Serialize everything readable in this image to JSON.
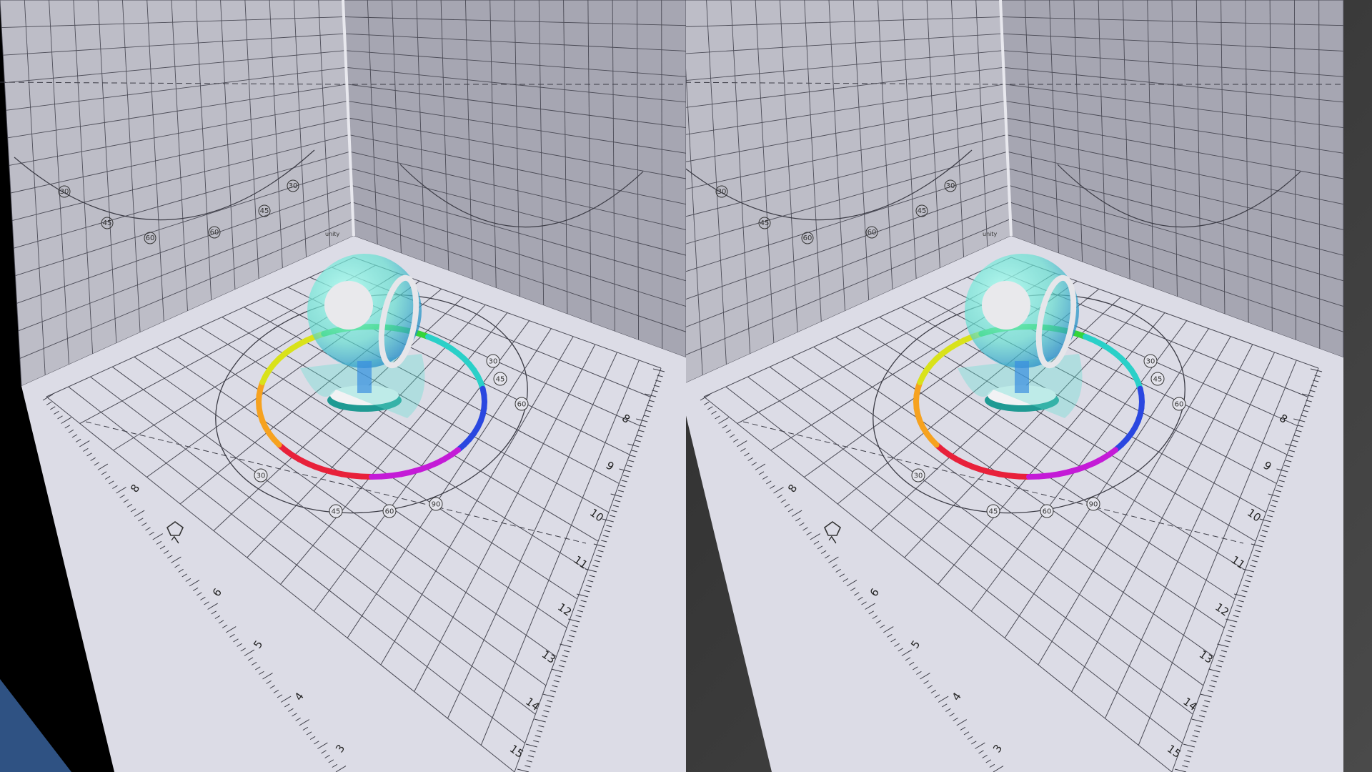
{
  "scene": {
    "views": [
      {
        "id": "left",
        "background": "#000000",
        "floor_color": "#dcdce6",
        "backwall_color": "#a6a6b2",
        "wall_brand": "unity",
        "wall_circle_labels": [
          "30",
          "45",
          "60",
          "60",
          "45",
          "30"
        ],
        "floor_circle_labels": [
          "30",
          "45",
          "60",
          "90",
          "60",
          "45",
          "30"
        ],
        "ruler_numbers": [
          "8",
          "9",
          "10",
          "11",
          "12",
          "13",
          "14",
          "15"
        ],
        "ruler_numbers_left": [
          "3",
          "4",
          "5",
          "6",
          "7",
          "8"
        ]
      },
      {
        "id": "right",
        "background": "#3a3a3a",
        "floor_color": "#dcdce6",
        "backwall_color": "#a6a6b2",
        "wall_brand": "unity",
        "wall_circle_labels": [
          "30",
          "45",
          "60",
          "60",
          "45",
          "30"
        ],
        "floor_circle_labels": [
          "30",
          "45",
          "60",
          "90",
          "60",
          "45",
          "30"
        ],
        "ruler_numbers": [
          "8",
          "9",
          "10",
          "11",
          "12",
          "13",
          "14",
          "15"
        ],
        "ruler_numbers_left": [
          "3",
          "4",
          "5",
          "6",
          "7",
          "8"
        ]
      }
    ],
    "accent_corner": "#2f5283",
    "glass_color": "#5fe0d0",
    "ring_colors": [
      "#e8213a",
      "#f6a21f",
      "#d9e21a",
      "#35d43a",
      "#2ad0c8",
      "#2a47e0",
      "#c41bd7",
      "#e8213a"
    ]
  }
}
